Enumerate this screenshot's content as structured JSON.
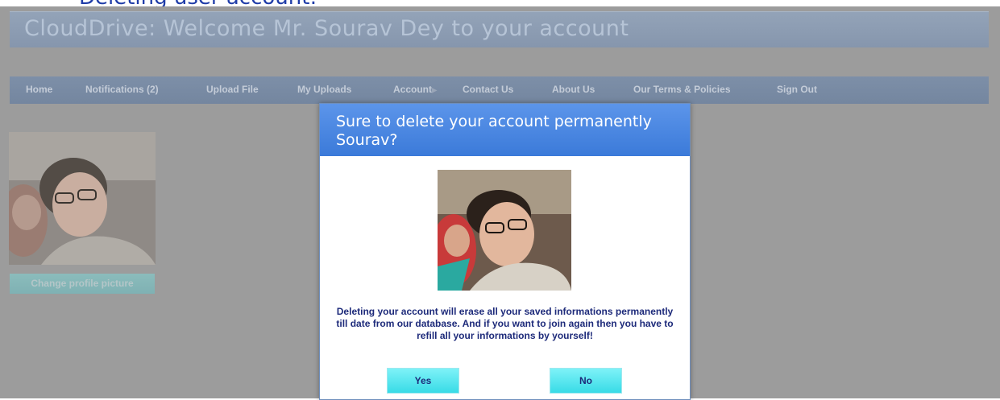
{
  "caption": "Deleting user account:",
  "header": {
    "title": "CloudDrive: Welcome Mr. Sourav Dey to your account"
  },
  "nav": {
    "items": [
      {
        "label": "Home"
      },
      {
        "label": "Notifications (2)"
      },
      {
        "label": "Upload File"
      },
      {
        "label": "My Uploads"
      },
      {
        "label": "Account"
      },
      {
        "label": "Contact Us"
      },
      {
        "label": "About Us"
      },
      {
        "label": "Our Terms & Policies"
      },
      {
        "label": "Sign Out"
      }
    ]
  },
  "profile": {
    "change_picture_label": "Change profile picture"
  },
  "modal": {
    "title": "Sure to delete your account permanently Sourav?",
    "message": "Deleting your account will erase all your saved informations permanently till date from our database. And if you want to join again then you have to refill all your informations by yourself!",
    "yes_label": "Yes",
    "no_label": "No"
  },
  "colors": {
    "header_bg": "#8a9ab0",
    "navbar_bg": "#7a8ca5",
    "modal_header": "#4a87e2",
    "button_bg": "#5ce8f0",
    "message_text": "#1d2a7a"
  }
}
